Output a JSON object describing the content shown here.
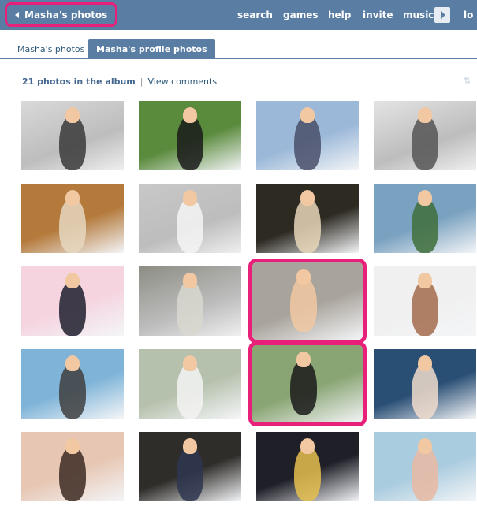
{
  "topbar": {
    "back_label": "Masha's photos",
    "nav": [
      "search",
      "games",
      "help",
      "invite",
      "music"
    ],
    "nav_overflow": "lo"
  },
  "tabs": [
    {
      "label": "Masha's photos",
      "active": false
    },
    {
      "label": "Masha's profile photos",
      "active": true
    }
  ],
  "album": {
    "count_text": "21 photos in the album",
    "separator": "|",
    "view_comments": "View comments"
  },
  "photos": [
    {
      "bg": "#d9d9d9",
      "fg": "#3a3a3a",
      "gray": true
    },
    {
      "bg": "#5a8a3c",
      "fg": "#1a1a1a",
      "gray": false
    },
    {
      "bg": "#9bb8d8",
      "fg": "#4a4f6a",
      "gray": false
    },
    {
      "bg": "#e4e4e4",
      "fg": "#555555",
      "gray": true
    },
    {
      "bg": "#b47a3c",
      "fg": "#e6d7c0",
      "gray": false
    },
    {
      "bg": "#c8c8c8",
      "fg": "#f5f5f5",
      "gray": true
    },
    {
      "bg": "#2d2a22",
      "fg": "#e7d6b8",
      "gray": false
    },
    {
      "bg": "#79a1c0",
      "fg": "#3f6f3a",
      "gray": false
    },
    {
      "bg": "#f5d4e0",
      "fg": "#1e1e2e",
      "gray": false
    },
    {
      "bg": "#8d8d85",
      "fg": "#d8d8d0",
      "gray": true
    },
    {
      "bg": "#a8a39b",
      "fg": "#f1c8a2",
      "gray": false
    },
    {
      "bg": "#f0f0f0",
      "fg": "#a36b4c",
      "gray": false
    },
    {
      "bg": "#7fb4d8",
      "fg": "#3f3f3f",
      "gray": false
    },
    {
      "bg": "#b6c1ad",
      "fg": "#f3f3f3",
      "gray": false
    },
    {
      "bg": "#8aa574",
      "fg": "#1a1a1a",
      "gray": false
    },
    {
      "bg": "#2a4f75",
      "fg": "#f0dccb",
      "gray": false
    },
    {
      "bg": "#e7c7b4",
      "fg": "#3c2a22",
      "gray": false
    },
    {
      "bg": "#2f2d2a",
      "fg": "#2e3650",
      "gray": false
    },
    {
      "bg": "#1f1f28",
      "fg": "#e5c04e",
      "gray": false
    },
    {
      "bg": "#aaccdf",
      "fg": "#e9b9a2",
      "gray": false
    }
  ],
  "highlight_color": "#e8207a",
  "accent_color": "#597da3",
  "icons": {
    "back": "triangle-left-icon",
    "more": "triangle-right-icon",
    "sort": "sort-arrows-icon"
  }
}
